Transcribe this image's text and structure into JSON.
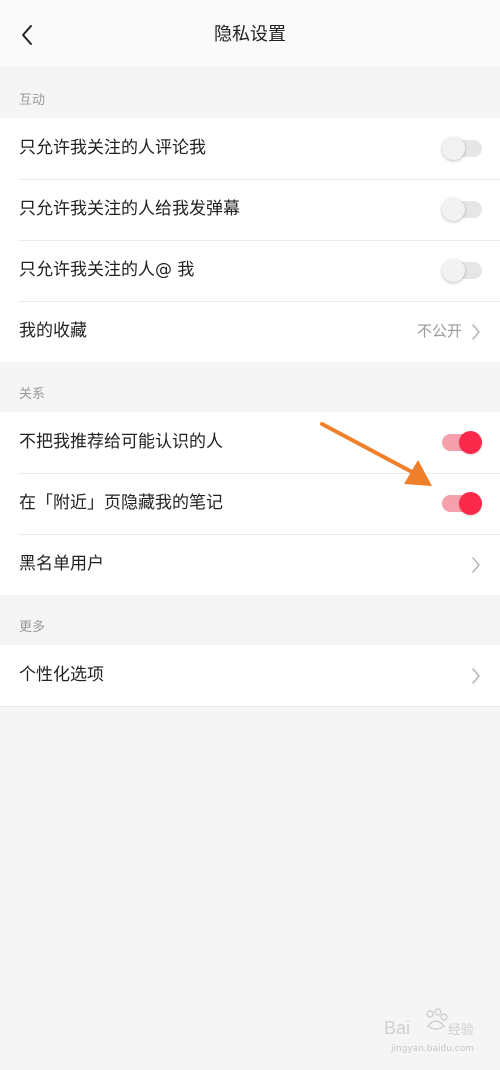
{
  "header": {
    "title": "隐私设置"
  },
  "sections": [
    {
      "label": "互动",
      "rows": [
        {
          "label": "只允许我关注的人评论我",
          "type": "toggle",
          "on": false
        },
        {
          "label": "只允许我关注的人给我发弹幕",
          "type": "toggle",
          "on": false
        },
        {
          "label": "只允许我关注的人@ 我",
          "type": "toggle",
          "on": false
        },
        {
          "label": "我的收藏",
          "type": "link",
          "value": "不公开"
        }
      ]
    },
    {
      "label": "关系",
      "rows": [
        {
          "label": "不把我推荐给可能认识的人",
          "type": "toggle",
          "on": true
        },
        {
          "label": "在「附近」页隐藏我的笔记",
          "type": "toggle",
          "on": true
        },
        {
          "label": "黑名单用户",
          "type": "link"
        }
      ]
    },
    {
      "label": "更多",
      "rows": [
        {
          "label": "个性化选项",
          "type": "link"
        }
      ]
    }
  ],
  "watermark": {
    "logo_text": "Bai",
    "sub_text": "jingyan.baidu.com"
  },
  "colors": {
    "accent": "#fb2a4a",
    "annotation_arrow": "#f07f2a"
  }
}
